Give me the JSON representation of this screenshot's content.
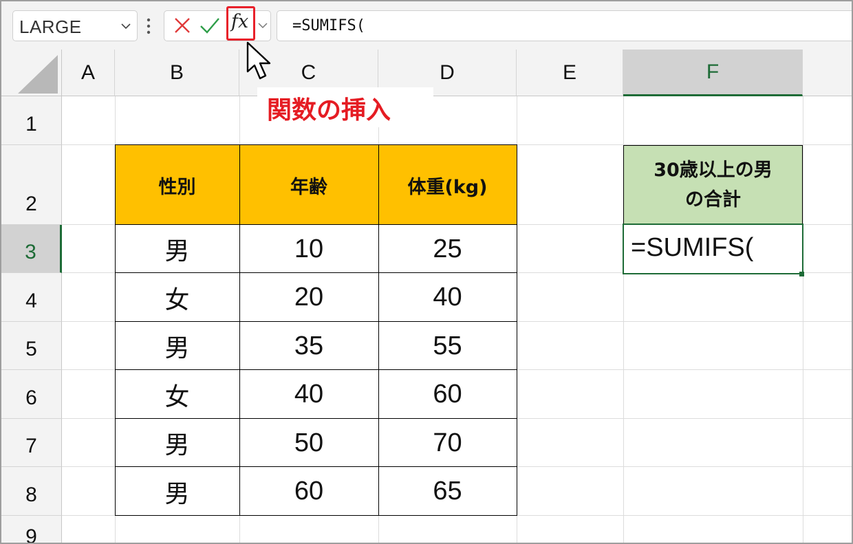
{
  "name_box": {
    "value": "LARGE"
  },
  "formula_bar": {
    "formula": "=SUMIFS("
  },
  "columns": [
    "A",
    "B",
    "C",
    "D",
    "E",
    "F"
  ],
  "selected_column": "F",
  "rows": [
    "1",
    "2",
    "3",
    "4",
    "5",
    "6",
    "7",
    "8",
    "9"
  ],
  "selected_row": "3",
  "table": {
    "headers": [
      "性別",
      "年齢",
      "体重(kg)"
    ],
    "rows": [
      [
        "男",
        "10",
        "25"
      ],
      [
        "女",
        "20",
        "40"
      ],
      [
        "男",
        "35",
        "55"
      ],
      [
        "女",
        "40",
        "60"
      ],
      [
        "男",
        "50",
        "70"
      ],
      [
        "男",
        "60",
        "65"
      ]
    ]
  },
  "summary_cell": {
    "label_line1": "30歳以上の男",
    "label_line2": "の合計",
    "editing_value": "=SUMIFS("
  },
  "annotation": {
    "text": "関数の挿入",
    "color": "#e51c23"
  },
  "colors": {
    "header_fill": "#ffc000",
    "summary_fill": "#c6e0b4",
    "selection_green": "#1d6b36",
    "highlight_red": "#e8202a"
  }
}
